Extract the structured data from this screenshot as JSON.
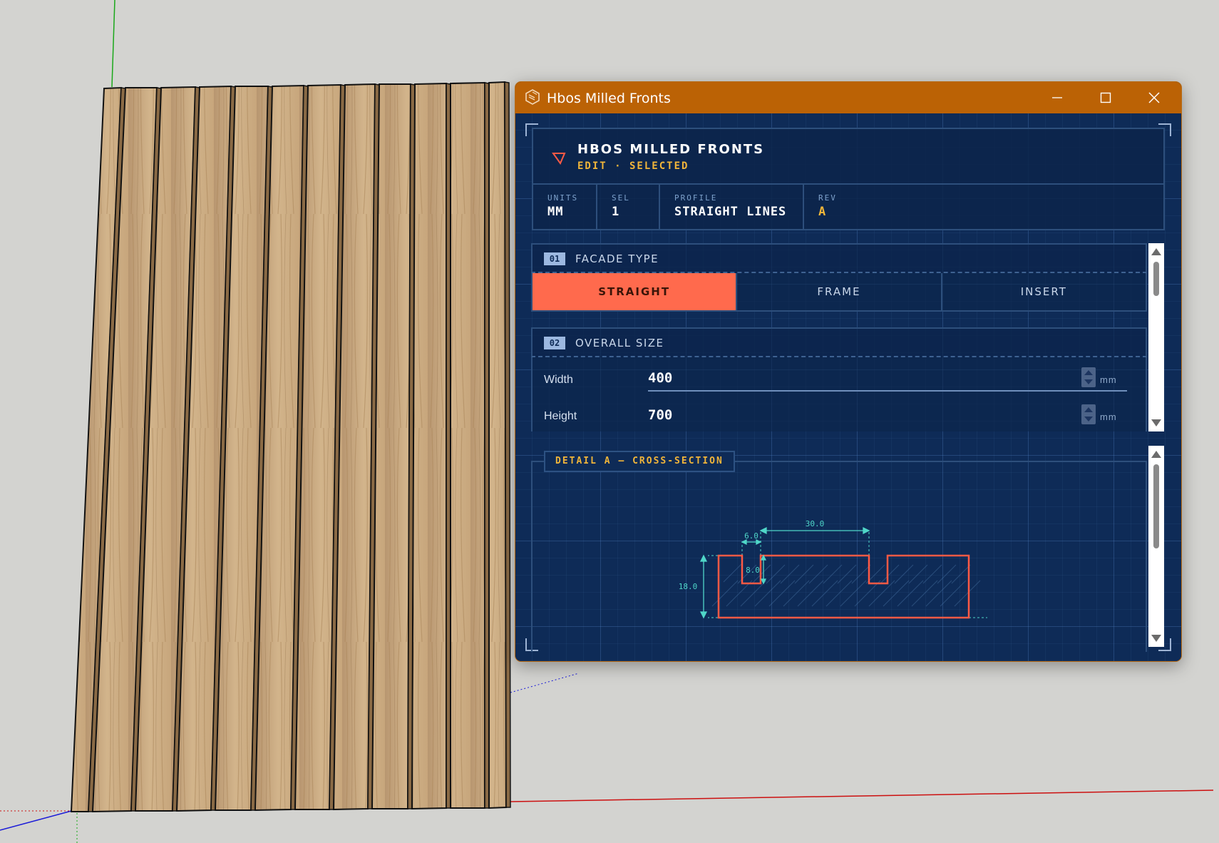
{
  "window": {
    "title": "Hbos Milled Fronts"
  },
  "header": {
    "title": "HBOS MILLED FRONTS",
    "subtitle": "EDIT · SELECTED",
    "meta": [
      {
        "label": "UNITS",
        "value": "MM"
      },
      {
        "label": "SEL",
        "value": "1"
      },
      {
        "label": "PROFILE",
        "value": "STRAIGHT LINES"
      },
      {
        "label": "REV",
        "value": "A"
      }
    ]
  },
  "sections": {
    "facade": {
      "number": "01",
      "title": "FACADE TYPE",
      "options": [
        "STRAIGHT",
        "FRAME",
        "INSERT"
      ],
      "selected": "STRAIGHT"
    },
    "size": {
      "number": "02",
      "title": "OVERALL SIZE",
      "width": {
        "label": "Width",
        "value": "400",
        "unit": "mm"
      },
      "height": {
        "label": "Height",
        "value": "700",
        "unit": "mm"
      }
    }
  },
  "detail": {
    "title": "DETAIL A — CROSS-SECTION",
    "dims": {
      "spacing": "30.0",
      "groove_width": "6.0",
      "groove_depth": "8.0",
      "thickness": "18.0"
    }
  },
  "colors": {
    "titlebar": "#bb6205",
    "panel_bg": "#0e2b57",
    "accent_active": "#ff6a4d",
    "accent_text": "#f0b53a",
    "dimension": "#4fd6c8",
    "profile_outline": "#ff5a45"
  }
}
